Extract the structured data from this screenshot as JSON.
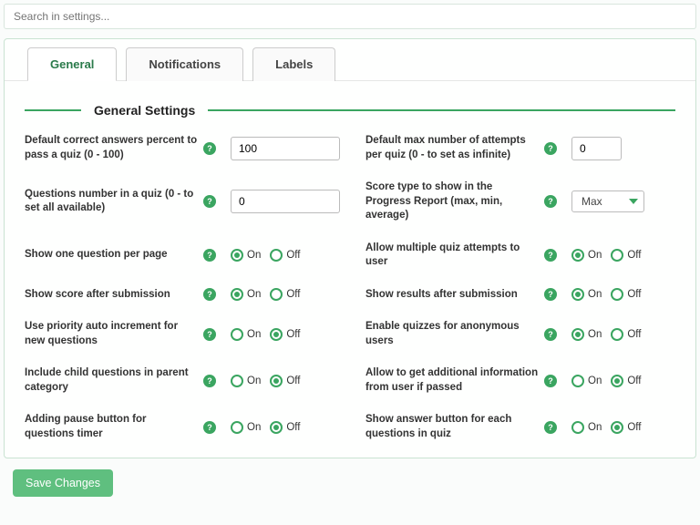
{
  "search": {
    "placeholder": "Search in settings..."
  },
  "tabs": {
    "general": "General",
    "notifications": "Notifications",
    "labels": "Labels"
  },
  "section": {
    "title": "General Settings"
  },
  "common": {
    "on": "On",
    "off": "Off",
    "help": "?"
  },
  "left": {
    "s0": {
      "label": "Default correct answers percent to pass a quiz (0 - 100)",
      "value": "100"
    },
    "s1": {
      "label": "Questions number in a quiz (0 - to set all available)",
      "value": "0"
    },
    "s2": {
      "label": "Show one question per page"
    },
    "s3": {
      "label": "Show score after submission"
    },
    "s4": {
      "label": "Use priority auto increment for new questions"
    },
    "s5": {
      "label": "Include child questions in parent category"
    },
    "s6": {
      "label": "Adding pause button for questions timer"
    }
  },
  "right": {
    "s0": {
      "label": "Default max number of attempts per quiz (0 - to set as infinite)",
      "value": "0"
    },
    "s1": {
      "label": "Score type to show in the Progress Report (max, min, average)",
      "value": "Max"
    },
    "s2": {
      "label": "Allow multiple quiz attempts to user"
    },
    "s3": {
      "label": "Show results after submission"
    },
    "s4": {
      "label": "Enable quizzes for anonymous users"
    },
    "s5": {
      "label": "Allow to get additional information from user if passed"
    },
    "s6": {
      "label": "Show answer button for each questions in quiz"
    }
  },
  "actions": {
    "save": "Save Changes"
  }
}
